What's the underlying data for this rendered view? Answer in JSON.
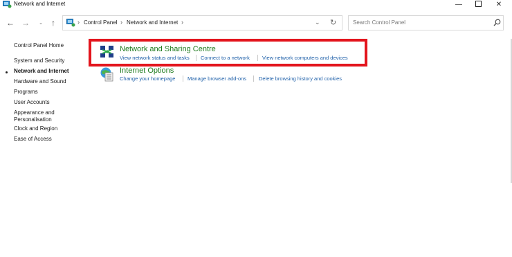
{
  "window": {
    "title": "Network and Internet",
    "minimize_glyph": "—",
    "close_glyph": "✕"
  },
  "nav": {
    "back_glyph": "←",
    "forward_glyph": "→",
    "recent_glyph": "⌄",
    "up_glyph": "↑"
  },
  "address": {
    "crumbs": [
      "Control Panel",
      "Network and Internet"
    ],
    "separator": "›",
    "dropdown_glyph": "⌄",
    "refresh_glyph": "↻"
  },
  "search": {
    "placeholder": "Search Control Panel"
  },
  "sidebar": {
    "items": [
      {
        "label": "Control Panel Home"
      },
      {
        "label": "System and Security"
      },
      {
        "label": "Network and Internet",
        "active": true
      },
      {
        "label": "Hardware and Sound"
      },
      {
        "label": "Programs"
      },
      {
        "label": "User Accounts"
      },
      {
        "label": "Appearance and"
      },
      {
        "label": "Personalisation"
      },
      {
        "label": "Clock and Region"
      },
      {
        "label": "Ease of Access"
      }
    ]
  },
  "categories": [
    {
      "title": "Network and Sharing Centre",
      "icon": "network-sharing-icon",
      "links": [
        "View network status and tasks",
        "Connect to a network",
        "View network computers and devices"
      ]
    },
    {
      "title": "Internet Options",
      "icon": "internet-options-icon",
      "links": [
        "Change your homepage",
        "Manage browser add-ons",
        "Delete browsing history and cookies"
      ]
    }
  ],
  "colors": {
    "highlight": "#e3151d",
    "category_title": "#1e7b1e",
    "link": "#1c5ea8"
  }
}
